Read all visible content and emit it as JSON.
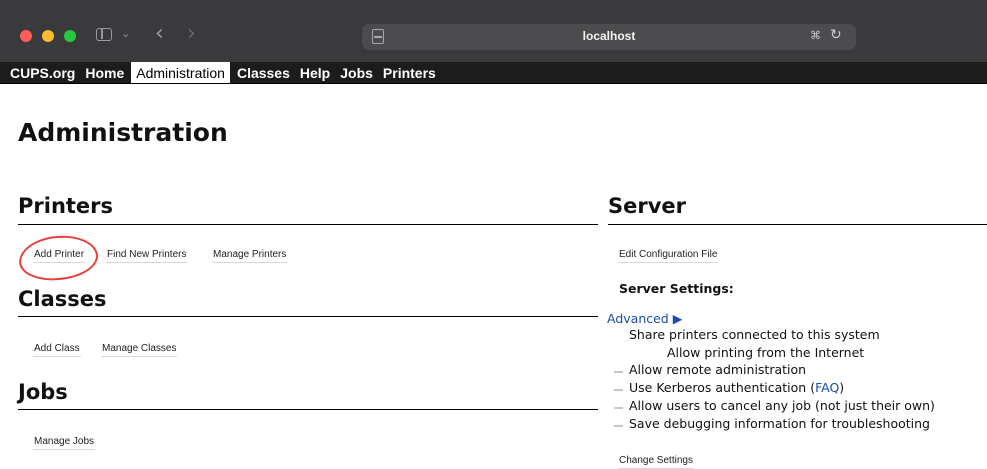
{
  "browser": {
    "url": "localhost"
  },
  "navbar": {
    "items": [
      "CUPS.org",
      "Home",
      "Administration",
      "Classes",
      "Help",
      "Jobs",
      "Printers"
    ],
    "active": "Administration"
  },
  "page": {
    "title": "Administration"
  },
  "printers": {
    "heading": "Printers",
    "buttons": [
      "Add Printer",
      "Find New Printers",
      "Manage Printers"
    ]
  },
  "classes": {
    "heading": "Classes",
    "buttons": [
      "Add Class",
      "Manage Classes"
    ]
  },
  "jobs": {
    "heading": "Jobs",
    "buttons": [
      "Manage Jobs"
    ]
  },
  "server": {
    "heading": "Server",
    "edit_config_label": "Edit Configuration File",
    "settings_title": "Server Settings:",
    "advanced_label": "Advanced ▶",
    "options": {
      "share_printers": "Share printers connected to this system",
      "allow_internet": "Allow printing from the Internet",
      "remote_admin": "Allow remote administration",
      "kerberos_pre": "Use Kerberos authentication (",
      "kerberos_link": "FAQ",
      "kerberos_post": ")",
      "cancel_any_job": "Allow users to cancel any job (not just their own)",
      "debug_info": "Save debugging information for troubleshooting"
    },
    "change_settings_label": "Change Settings"
  },
  "colors": {
    "navbar_bg": "#1c1c1c",
    "link": "#1a4ca8",
    "annotation": "#e8413c"
  }
}
